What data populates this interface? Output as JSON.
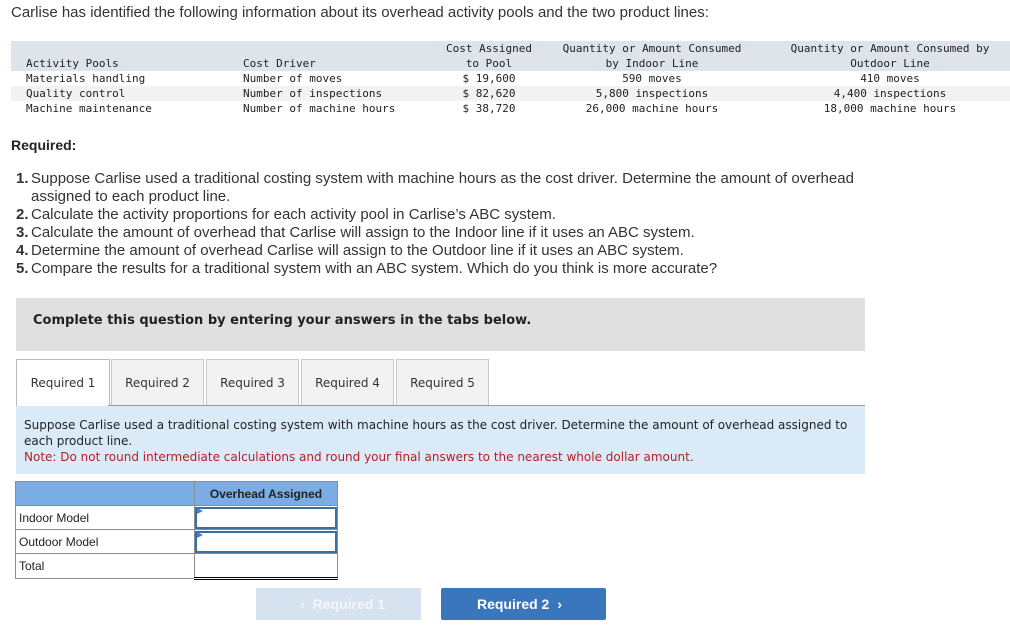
{
  "intro": "Carlise has identified the following information about its overhead activity pools and the two product lines:",
  "data_table": {
    "headers": {
      "activity_pools": "Activity Pools",
      "cost_driver": "Cost Driver",
      "cost_assigned_1": "Cost Assigned",
      "cost_assigned_2": "to Pool",
      "indoor_1": "Quantity or Amount Consumed",
      "indoor_2": "by Indoor Line",
      "outdoor_1": "Quantity or Amount Consumed by",
      "outdoor_2": "Outdoor Line"
    },
    "rows": [
      {
        "pool": "Materials handling",
        "driver": "Number of moves",
        "cost": "$ 19,600",
        "indoor": "590 moves",
        "outdoor": "410 moves"
      },
      {
        "pool": "Quality control",
        "driver": "Number of inspections",
        "cost": "$ 82,620",
        "indoor": "5,800 inspections",
        "outdoor": "4,400 inspections"
      },
      {
        "pool": "Machine maintenance",
        "driver": "Number of machine hours",
        "cost": "$ 38,720",
        "indoor": "26,000 machine hours",
        "outdoor": "18,000 machine hours"
      }
    ]
  },
  "required": {
    "title": "Required:",
    "items": [
      {
        "num": "1.",
        "text": "Suppose Carlise used a traditional costing system with machine hours as the cost driver. Determine the amount of overhead assigned to each product line."
      },
      {
        "num": "2.",
        "text": "Calculate the activity proportions for each activity pool in Carlise’s ABC system."
      },
      {
        "num": "3.",
        "text": "Calculate the amount of overhead that Carlise will assign to the Indoor line if it uses an ABC system."
      },
      {
        "num": "4.",
        "text": "Determine the amount of overhead Carlise will assign to the Outdoor line if it uses an ABC system."
      },
      {
        "num": "5.",
        "text": "Compare the results for a traditional system with an ABC system. Which do you think is more accurate?"
      }
    ]
  },
  "instruction": "Complete this question by entering your answers in the tabs below.",
  "tabs": [
    {
      "label": "Required 1",
      "active": true
    },
    {
      "label": "Required 2",
      "active": false
    },
    {
      "label": "Required 3",
      "active": false
    },
    {
      "label": "Required 4",
      "active": false
    },
    {
      "label": "Required 5",
      "active": false
    }
  ],
  "question": {
    "text": "Suppose Carlise used a traditional costing system with machine hours as the cost driver. Determine the amount of overhead assigned to each product line.",
    "note": "Note: Do not round intermediate calculations and round your final answers to the nearest whole dollar amount."
  },
  "answer_table": {
    "header": "Overhead Assigned",
    "rows": [
      {
        "label": "Indoor Model",
        "value": ""
      },
      {
        "label": "Outdoor Model",
        "value": ""
      },
      {
        "label": "Total",
        "value": ""
      }
    ]
  },
  "nav": {
    "prev_label": "Required 1",
    "next_label": "Required 2",
    "prev_icon": "‹",
    "next_icon": "›"
  },
  "colors": {
    "primary_button": "#3a76bc",
    "disabled_button": "#d6e2f0",
    "table_header": "#7aade6",
    "question_bg": "#dbeaf7",
    "note_text": "#b22222"
  }
}
